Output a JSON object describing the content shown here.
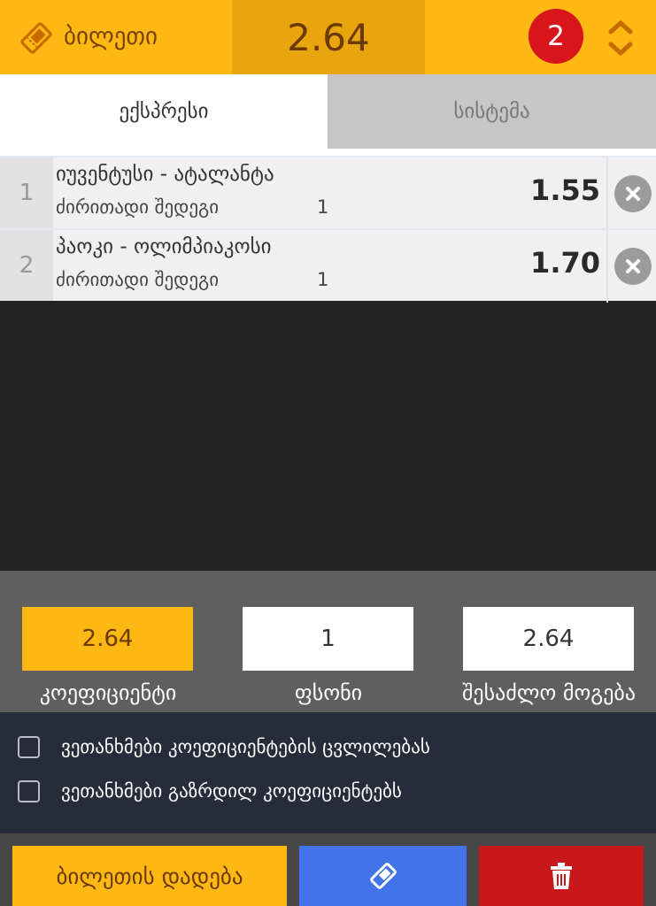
{
  "header": {
    "title": "ბილეთი",
    "total_odds": "2.64",
    "selection_count": "2",
    "icons": {
      "ticket": "ticket-icon",
      "toggle": "expand-collapse-icon"
    }
  },
  "tabs": [
    {
      "label": "ექსპრესი",
      "active": true
    },
    {
      "label": "სისტემა",
      "active": false
    }
  ],
  "bets": [
    {
      "index": "1",
      "match": "იუვენტუსი - ატალანტა",
      "market": "ძირითადი შედეგი",
      "outcome": "1",
      "odd": "1.55"
    },
    {
      "index": "2",
      "match": "პაოკი - ოლიმპიაკოსი",
      "market": "ძირითადი შედეგი",
      "outcome": "1",
      "odd": "1.70"
    }
  ],
  "summary": {
    "coefficient": {
      "value": "2.64",
      "label": "კოეფიციენტი"
    },
    "stake": {
      "value": "1",
      "label": "ფსონი"
    },
    "possible_win": {
      "value": "2.64",
      "label": "შესაძლო მოგება"
    }
  },
  "options": [
    {
      "label": "ვეთანხმები კოეფიციენტების ცვლილებას",
      "checked": false
    },
    {
      "label": "ვეთანხმები გაზრდილ კოეფიციენტებს",
      "checked": false
    }
  ],
  "footer": {
    "place_bet_label": "ბილეთის დადება",
    "icons": {
      "ticket": "ticket-icon",
      "delete": "trash-icon"
    }
  },
  "colors": {
    "accent": "#fdb814",
    "accent_dark": "#e9a50d",
    "badge": "#d8151b",
    "blue": "#4273e8",
    "red": "#c8181c"
  }
}
